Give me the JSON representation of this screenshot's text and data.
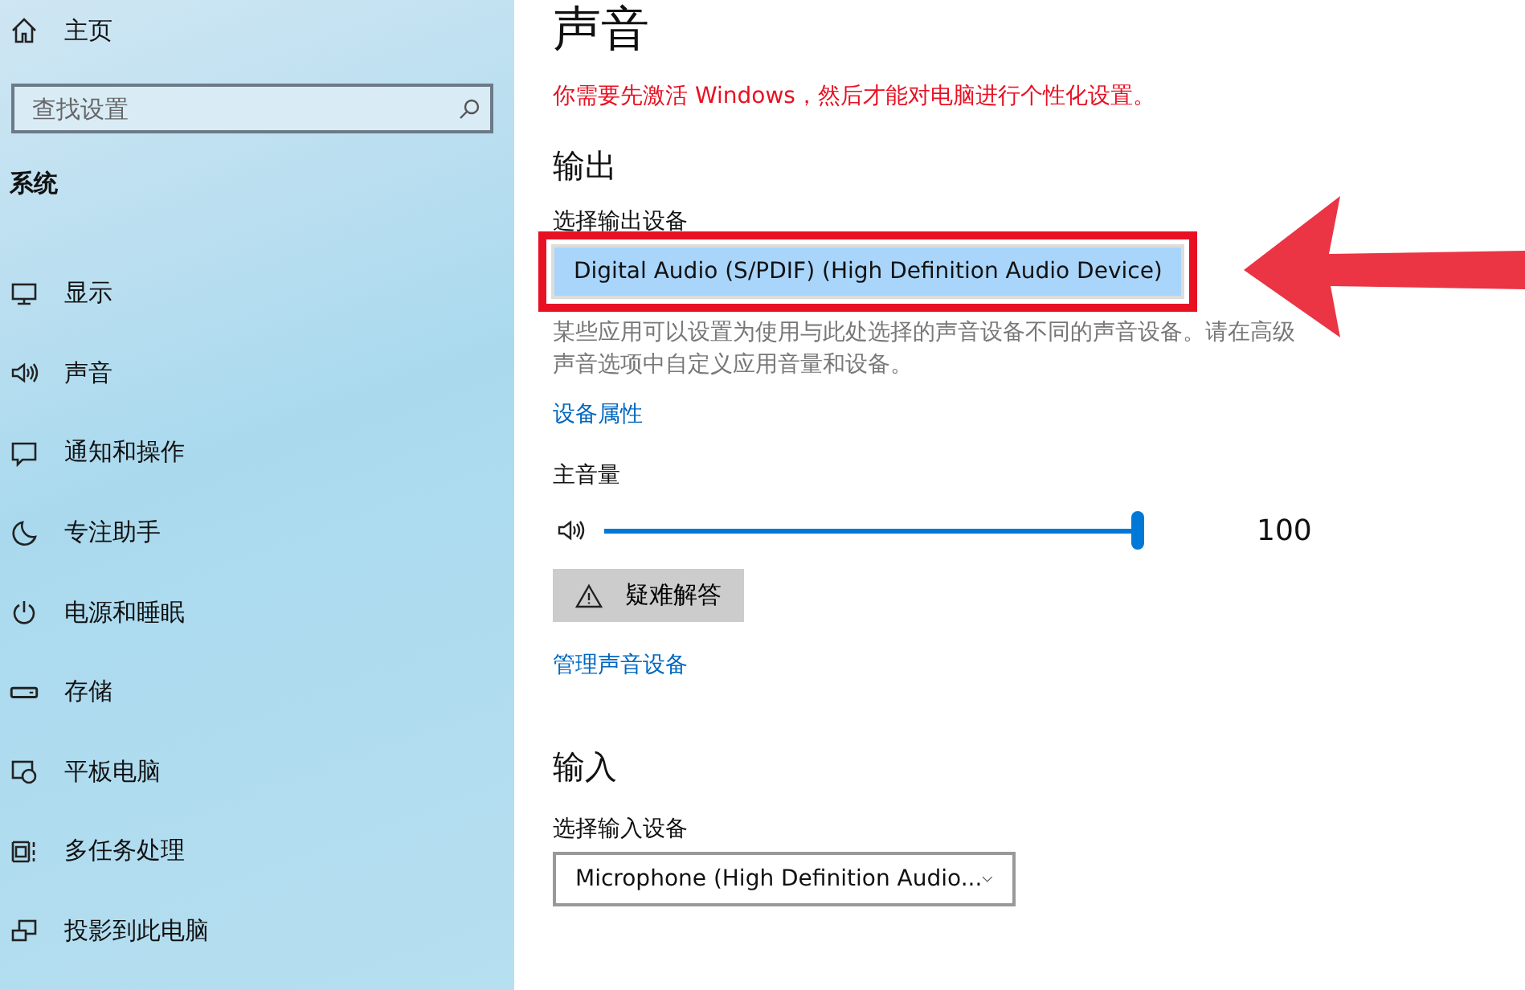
{
  "sidebar": {
    "home": {
      "label": "主页"
    },
    "search": {
      "placeholder": "查找设置"
    },
    "section_title": "系统",
    "items": [
      {
        "label": "显示"
      },
      {
        "label": "声音"
      },
      {
        "label": "通知和操作"
      },
      {
        "label": "专注助手"
      },
      {
        "label": "电源和睡眠"
      },
      {
        "label": "存储"
      },
      {
        "label": "平板电脑"
      },
      {
        "label": "多任务处理"
      },
      {
        "label": "投影到此电脑"
      }
    ]
  },
  "main": {
    "title": "声音",
    "warning": "你需要先激活 Windows，然后才能对电脑进行个性化设置。",
    "output": {
      "heading": "输出",
      "device_label": "选择输出设备",
      "device": "Digital Audio (S/PDIF) (High Definition Audio Device)",
      "highlighted": true,
      "note": "某些应用可以设置为使用与此处选择的声音设备不同的声音设备。请在高级声音选项中自定义应用音量和设备。",
      "properties_link": "设备属性",
      "volume_label": "主音量",
      "volume": {
        "level": 1.0
      },
      "volume_reading": "100",
      "troubleshoot": "疑难解答",
      "manage_link": "管理声音设备"
    },
    "input": {
      "heading": "输入",
      "device_label": "选择输入设备",
      "device": "Microphone (High Definition Audio..."
    }
  }
}
